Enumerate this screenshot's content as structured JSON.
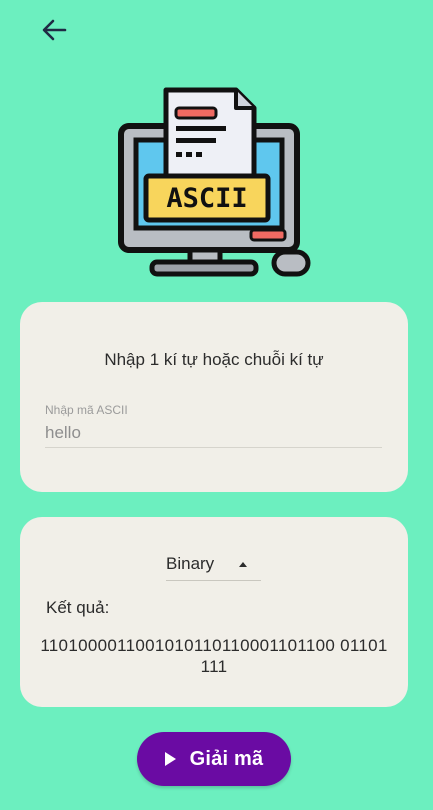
{
  "header": {
    "back_icon": "arrow-left-icon"
  },
  "hero": {
    "icon": "ascii-computer-icon",
    "badge_text": "ASCII"
  },
  "input_card": {
    "prompt": "Nhập 1 kí tự hoặc chuỗi kí tự",
    "field_label": "Nhập mã ASCII",
    "field_value": "hello"
  },
  "result_card": {
    "format_selected": "Binary",
    "result_label": "Kết quả:",
    "result_value": "1101000011001010110110001101100 01101111"
  },
  "action": {
    "decode_label": "Giải mã",
    "icon": "play-icon"
  },
  "colors": {
    "background": "#6cefbf",
    "card": "#f1efe8",
    "button": "#6a0ba3"
  }
}
